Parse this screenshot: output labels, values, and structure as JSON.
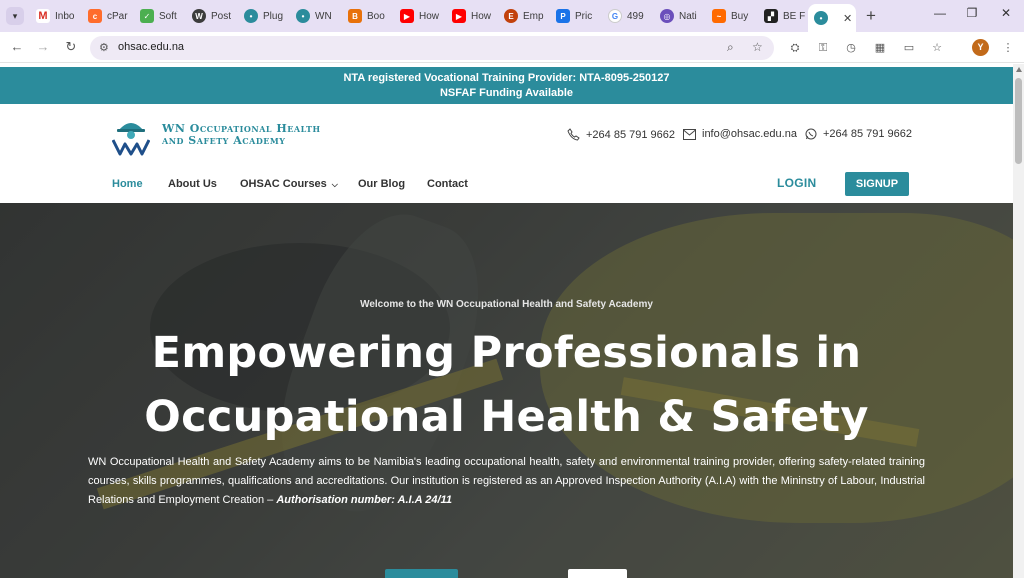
{
  "browser": {
    "tabs": [
      {
        "title": "Inbo",
        "icon": "gmail-icon",
        "color": "#d93025"
      },
      {
        "title": "cPar",
        "icon": "cpanel-icon",
        "color": "#ff6c2c"
      },
      {
        "title": "Soft",
        "icon": "softaculous-icon",
        "color": "#4caf50"
      },
      {
        "title": "Post",
        "icon": "wordpress-icon",
        "color": "#3c3c3c"
      },
      {
        "title": "Plug",
        "icon": "site-icon",
        "color": "#2b8c9c"
      },
      {
        "title": "WN",
        "icon": "site-icon",
        "color": "#2b8c9c"
      },
      {
        "title": "Boo",
        "icon": "bookmark-icon",
        "color": "#e8710a"
      },
      {
        "title": "How",
        "icon": "youtube-icon",
        "color": "#ff0000"
      },
      {
        "title": "How",
        "icon": "youtube-icon",
        "color": "#ff0000"
      },
      {
        "title": "Emp",
        "icon": "app-icon",
        "color": "#c2410c"
      },
      {
        "title": "Pric",
        "icon": "pricing-icon",
        "color": "#1a73e8"
      },
      {
        "title": "499",
        "icon": "google-icon",
        "color": "#4285f4"
      },
      {
        "title": "Nati",
        "icon": "circle-icon",
        "color": "#6b4fbb"
      },
      {
        "title": "Buy",
        "icon": "buy-icon",
        "color": "#ff6a00"
      },
      {
        "title": "BE F",
        "icon": "be-icon",
        "color": "#222222"
      },
      {
        "title": "",
        "icon": "site-icon",
        "color": "#2b8c9c"
      }
    ],
    "url": "ohsac.edu.na"
  },
  "topbar": {
    "line1": "NTA registered Vocational Training Provider: NTA-8095-250127",
    "line2": "NSFAF Funding Available"
  },
  "header": {
    "logo_line1": "WN Occupational Health",
    "logo_line2": "and Safety Academy",
    "phone": "+264 85 791 9662",
    "email": "info@ohsac.edu.na",
    "whatsapp": "+264 85 791 9662"
  },
  "nav": {
    "home": "Home",
    "about": "About Us",
    "courses": "OHSAC Courses",
    "blog": "Our Blog",
    "contact": "Contact",
    "login": "LOGIN",
    "signup": "SIGNUP"
  },
  "hero": {
    "welcome": "Welcome to the WN Occupational Health and Safety Academy",
    "title_line1": "Empowering Professionals in",
    "title_line2": "Occupational Health & Safety",
    "description": "WN Occupational Health and Safety Academy aims to be Namibia's leading occupational health, safety and environmental training provider, offering  safety-related training courses, skills programmes, qualifications and accreditations. Our institution is registered as an Approved Inspection Authority (A.I.A) with the Mininstry of Labour, Industrial Relations and Employment Creation –",
    "authorisation": "Authorisation number: A.I.A 24/11"
  },
  "colors": {
    "brand": "#2b8c9c",
    "tabstrip": "#e7e0f4"
  }
}
